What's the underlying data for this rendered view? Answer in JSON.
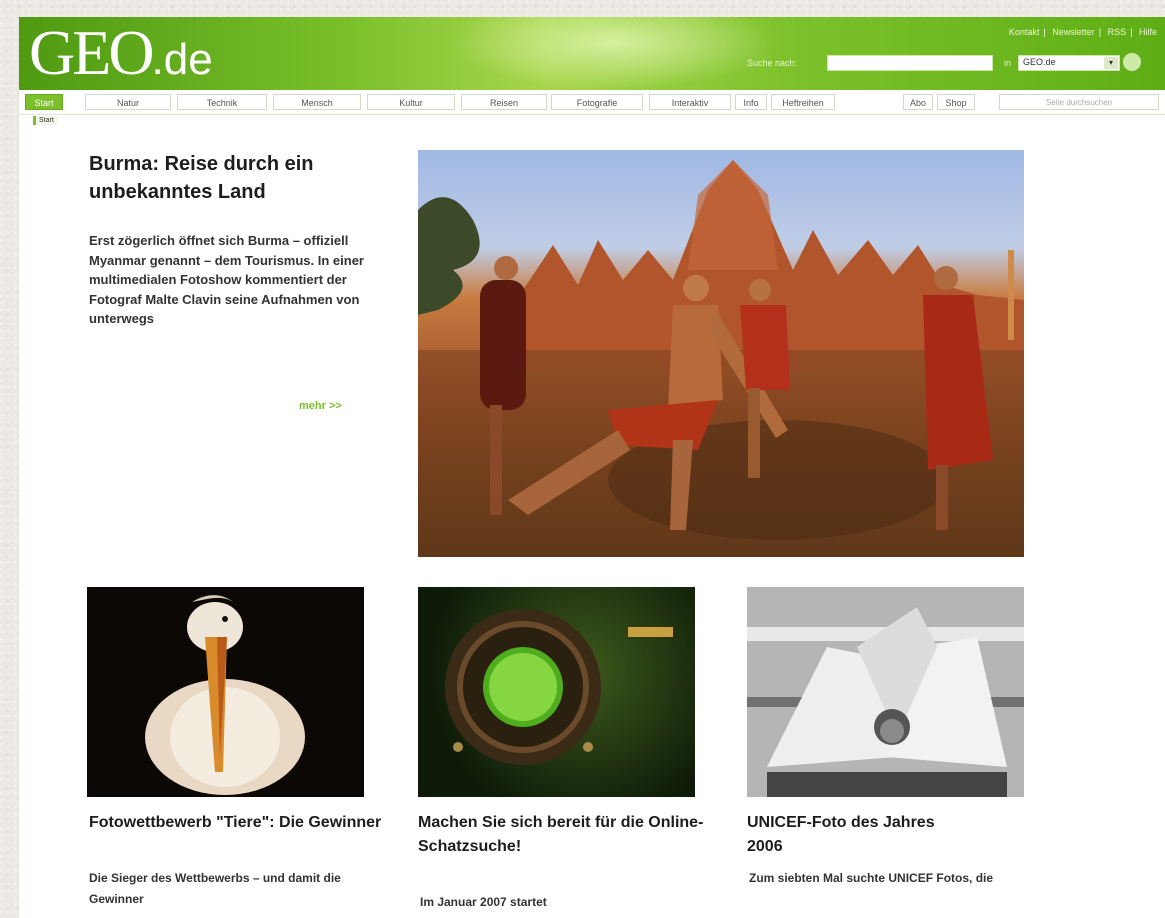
{
  "site": {
    "logo_main": "GEO",
    "logo_suffix": ".de"
  },
  "header": {
    "toplinks": [
      "Kontakt",
      "Newsletter",
      "RSS",
      "Hilfe"
    ],
    "search_label": "Suche nach:",
    "search_value": "",
    "search_in_label": "in",
    "search_scope": "GEO.de"
  },
  "nav": {
    "tabs": [
      {
        "label": "Start",
        "active": true
      },
      {
        "label": "Natur",
        "active": false
      },
      {
        "label": "Technik",
        "active": false
      },
      {
        "label": "Mensch",
        "active": false
      },
      {
        "label": "Kultur",
        "active": false
      },
      {
        "label": "Reisen",
        "active": false
      },
      {
        "label": "Fotografie",
        "active": false
      },
      {
        "label": "Interaktiv",
        "active": false
      },
      {
        "label": "Info",
        "active": false
      },
      {
        "label": "Heftreihen",
        "active": false
      },
      {
        "label": "Abo",
        "active": false
      },
      {
        "label": "Shop",
        "active": false
      }
    ],
    "search_placeholder": "Seite durchsuchen"
  },
  "breadcrumb": "Start",
  "hero": {
    "title": "Burma: Reise durch ein unbekanntes Land",
    "text": "Erst zögerlich öffnet sich Burma – offiziell Myanmar genannt – dem Tourismus. In einer multimedialen Fotoshow kommentiert der Fotograf Malte Clavin seine Aufnahmen von unterwegs",
    "more": "mehr >>"
  },
  "teasers": [
    {
      "title": "Fotowettbewerb \"Tiere\": Die Gewinner",
      "text": "Die Sieger des Wettbewerbs – und damit die Gewinner"
    },
    {
      "title": "Machen Sie sich bereit für die Online-Schatzsuche!",
      "text": "Im Januar 2007 startet"
    },
    {
      "title": "UNICEF-Foto des Jahres 2006",
      "text": "Zum siebten Mal suchte UNICEF Fotos, die"
    }
  ],
  "colors": {
    "brand_green": "#7bbf2b",
    "header_dark_green": "#4f9a12",
    "text_dark": "#1d1d1d"
  }
}
